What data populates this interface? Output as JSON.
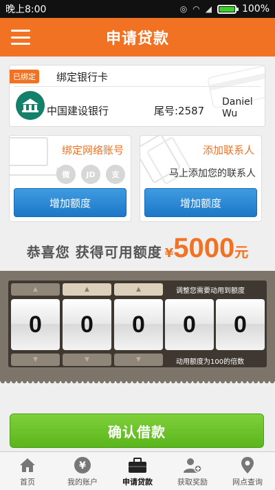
{
  "status": {
    "time": "晚上8:00",
    "battery": "100%",
    "battery_level": 1.0
  },
  "header": {
    "title": "申请贷款"
  },
  "bank_card": {
    "badge": "已绑定",
    "title": "绑定银行卡",
    "bank_name": "中国建设银行",
    "tail_number": "尾号:2587",
    "holder": "Daniel Wu"
  },
  "network_account": {
    "title": "绑定网络账号",
    "icons": [
      "weibo-icon",
      "jd-icon",
      "alipay-icon"
    ],
    "icon_labels": [
      "微",
      "JD",
      "支"
    ],
    "button": "增加额度"
  },
  "contacts": {
    "title": "添加联系人",
    "subtitle": "马上添加您的联系人",
    "button": "增加额度"
  },
  "congrats": {
    "text": "恭喜您 获得可用额度",
    "currency": "¥",
    "amount": "5000",
    "unit": "元"
  },
  "counter": {
    "digits": [
      "0",
      "0",
      "0",
      "0",
      "0"
    ],
    "hint_top": "调整您需要动用到额度",
    "hint_bottom": "动用额度为100的倍数"
  },
  "confirm_button": "确认借款",
  "tabs": [
    {
      "label": "首页",
      "icon": "home-icon"
    },
    {
      "label": "我的账户",
      "icon": "yen-icon"
    },
    {
      "label": "申请贷款",
      "icon": "briefcase-icon",
      "active": true
    },
    {
      "label": "获取奖励",
      "icon": "add-user-icon"
    },
    {
      "label": "网点查询",
      "icon": "location-pin-icon"
    }
  ],
  "colors": {
    "accent": "#f07222",
    "blue_button": "#2a86d3",
    "green_button": "#6cc22a",
    "bank_logo": "#12806b"
  }
}
